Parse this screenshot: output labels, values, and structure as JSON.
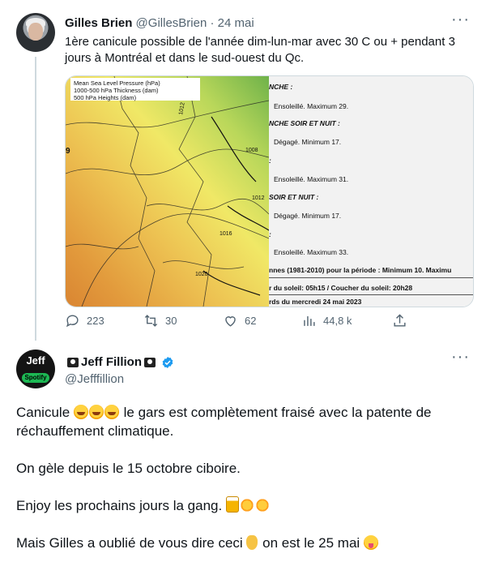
{
  "tweet1": {
    "author_name": "Gilles Brien",
    "handle": "@GillesBrien",
    "separator": "·",
    "date": "24 mai",
    "more": "···",
    "text": "1ère canicule possible de l'année dim-lun-mar avec 30 C ou + pendant 3 jours à Montréal et dans le sud-ouest du Qc.",
    "map_legend": [
      "Mean Sea Level Pressure (hPa)",
      "1000-500 hPa Thickness (dam)",
      "500 hPa Heights (dam)"
    ],
    "map_contour_labels": [
      "1012",
      "1008",
      "1012",
      "1016",
      "1020",
      "9"
    ],
    "forecast_lines": [
      "NCHE :",
      "Ensoleillé. Maximum 29.",
      "NCHE SOIR ET NUIT :",
      "Dégagé. Minimum 17.",
      ":",
      "Ensoleillé. Maximum 31.",
      "SOIR ET NUIT :",
      "Dégagé. Minimum 17.",
      ":",
      "Ensoleillé. Maximum 33.",
      "nnes (1981-2010) pour la période : Minimum 10. Maximu",
      "r du soleil: 05h15 / Coucher du soleil: 20h28",
      "rds du mercredi 24 mai 2023"
    ],
    "actions": {
      "replies": "223",
      "retweets": "30",
      "likes": "62",
      "views": "44,8 k"
    }
  },
  "tweet2": {
    "author_name": "Jeff Fillion",
    "handle": "@Jefffillion",
    "more": "···",
    "avatar_text_top": "Jeff",
    "avatar_text_bottom": "Spotify",
    "p1_a": "Canicule",
    "p1_b": "le gars est complètement fraisé avec la patente de",
    "p1_c": "réchauffement climatique.",
    "p2": "On gèle depuis le 15 octobre ciboire.",
    "p3": "Enjoy les prochains jours la gang.",
    "p4_a": "Mais Gilles a oublié de vous dire ceci",
    "p4_b": "on est le 25 mai",
    "emoji_names": [
      "rofl-emoji",
      "beer-emoji",
      "sun-emoji",
      "pointing-down-emoji",
      "tongue-emoji"
    ]
  },
  "colors": {
    "text": "#0f1419",
    "muted": "#536471",
    "verified_blue": "#1d9bf0",
    "border": "#cfd9de"
  }
}
